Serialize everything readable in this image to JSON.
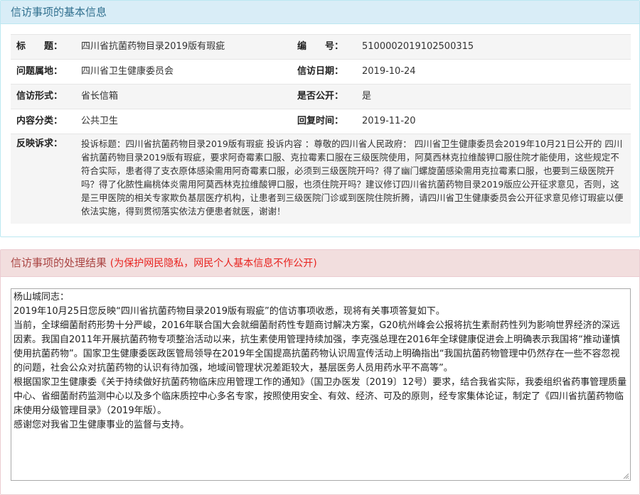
{
  "info_panel": {
    "title": "信访事项的基本信息",
    "rows": [
      {
        "label1": "标　　题：",
        "value1": "四川省抗菌药物目录2019版有瑕疵",
        "label2": "编　　号：",
        "value2": "5100002019102500315"
      },
      {
        "label1": "问题属地：",
        "value1": "四川省卫生健康委员会",
        "label2": "信访日期：",
        "value2": "2019-10-24"
      },
      {
        "label1": "信访形式：",
        "value1": "省长信箱",
        "label2": "是否公开：",
        "value2": "是"
      },
      {
        "label1": "内容分类：",
        "value1": "公共卫生",
        "label2": "回复时间：",
        "value2": "2019-11-20"
      }
    ],
    "feedback_label": "反映诉求：",
    "feedback_text": "投诉标题：四川省抗菌药物目录2019版有瑕疵 投诉内容 ：尊敬的四川省人民政府： 四川省卫生健康委员会2019年10月21日公开的 四川省抗菌药物目录2019版有瑕疵，要求阿奇霉素口服、克拉霉素口服在三级医院使用，阿莫西林克拉维酸钾口服住院才能使用，这些规定不符合实际，患者得了支衣原体感染需用阿奇霉素口服，必须到三级医院开吗？得了幽门螺旋菌感染需用克拉霉素口服，也要到三级医院开吗？得了化脓性扁桃体炎需用阿莫西林克拉维酸钾口服，也须住院开吗？建议修订四川省抗菌药物目录2019版应公开征求意见，否则，这是三甲医院的相关专家欺负基层医疗机构，让患者到三级医院门诊或到医院住院折腾，请四川省卫生健康委员会公开征求意见修订瑕疵以便依法实施，得到贯彻落实依法方便患者就医，谢谢！"
  },
  "result_panel": {
    "title": "信访事项的处理结果",
    "note": "(为保护网民隐私，网民个人基本信息不作公开)",
    "reply_lines": [
      "杨山城同志：",
      "2019年10月25日您反映“四川省抗菌药物目录2019版有瑕疵”的信访事项收悉，现将有关事项答复如下。",
      "当前，全球细菌耐药形势十分严峻，2016年联合国大会就细菌耐药性专题商讨解决方案，G20杭州峰会公报将抗生素耐药性列为影响世界经济的深远因素。我国自2011年开展抗菌药物专项整治活动以来，抗生素使用管理持续加强，李克强总理在2016年全球健康促进会上明确表示我国将“推动谨慎使用抗菌药物”。国家卫生健康委医政医管局领导在2019年全国提高抗菌药物认识周宣传活动上明确指出“我国抗菌药物管理中仍然存在一些不容忽视的问题，社会公众对抗菌药物的认识有待加强，地域间管理状况差距较大，基层医务人员用药水平不高等”。",
      "根据国家卫生健康委《关于持续做好抗菌药物临床应用管理工作的通知》（国卫办医发〔2019〕12号）要求，结合我省实际，我委组织省药事管理质量中心、省细菌耐药监测中心以及多个临床质控中心多名专家，按照使用安全、有效、经济、可及的原则，经专家集体论证，制定了《四川省抗菌药物临床使用分级管理目录》（2019年版）。",
      "感谢您对我省卫生健康事业的监督与支持。"
    ]
  }
}
